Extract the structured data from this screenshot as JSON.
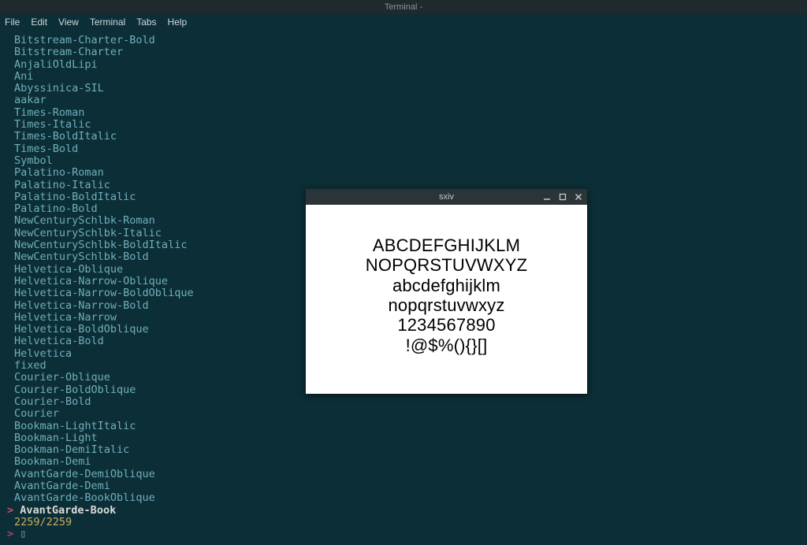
{
  "titlebar": {
    "text": "Terminal -"
  },
  "menubar": {
    "items": [
      "File",
      "Edit",
      "View",
      "Terminal",
      "Tabs",
      "Help"
    ]
  },
  "fonts": [
    "Bitstream-Charter-Bold",
    "Bitstream-Charter",
    "AnjaliOldLipi",
    "Ani",
    "Abyssinica-SIL",
    "aakar",
    "Times-Roman",
    "Times-Italic",
    "Times-BoldItalic",
    "Times-Bold",
    "Symbol",
    "Palatino-Roman",
    "Palatino-Italic",
    "Palatino-BoldItalic",
    "Palatino-Bold",
    "NewCenturySchlbk-Roman",
    "NewCenturySchlbk-Italic",
    "NewCenturySchlbk-BoldItalic",
    "NewCenturySchlbk-Bold",
    "Helvetica-Oblique",
    "Helvetica-Narrow-Oblique",
    "Helvetica-Narrow-BoldOblique",
    "Helvetica-Narrow-Bold",
    "Helvetica-Narrow",
    "Helvetica-BoldOblique",
    "Helvetica-Bold",
    "Helvetica",
    "fixed",
    "Courier-Oblique",
    "Courier-BoldOblique",
    "Courier-Bold",
    "Courier",
    "Bookman-LightItalic",
    "Bookman-Light",
    "Bookman-DemiItalic",
    "Bookman-Demi",
    "AvantGarde-DemiOblique",
    "AvantGarde-Demi",
    "AvantGarde-BookOblique"
  ],
  "selected": {
    "marker": ">",
    "name": "AvantGarde-Book"
  },
  "count": "2259/2259",
  "prompt": {
    "caret": ">",
    "cursor": "▯"
  },
  "sxiv": {
    "title": "sxiv",
    "lines": [
      "ABCDEFGHIJKLM",
      "NOPQRSTUVWXYZ",
      "abcdefghijklm",
      "nopqrstuvwxyz",
      "1234567890",
      "!@$%(){}[]"
    ]
  }
}
